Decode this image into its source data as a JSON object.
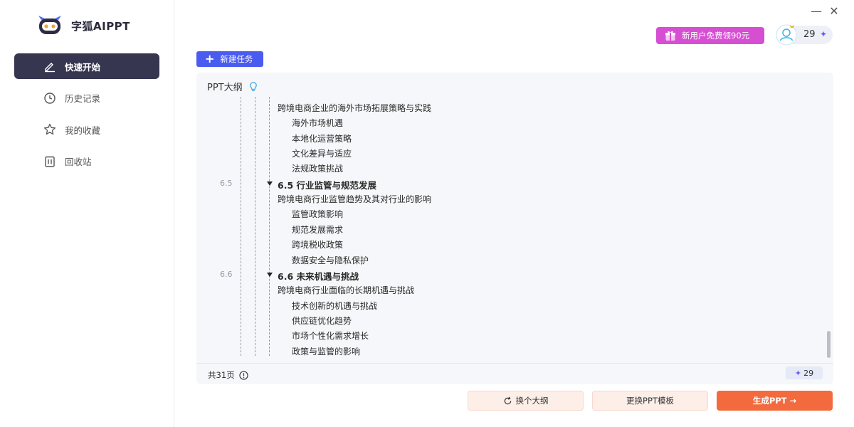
{
  "brand": {
    "name": "字狐AIPPT"
  },
  "sidebar": {
    "items": [
      {
        "label": "快速开始",
        "active": true,
        "icon": "pencil-icon"
      },
      {
        "label": "历史记录",
        "active": false,
        "icon": "clock-icon"
      },
      {
        "label": "我的收藏",
        "active": false,
        "icon": "star-icon"
      },
      {
        "label": "回收站",
        "active": false,
        "icon": "trash-icon"
      }
    ]
  },
  "window": {
    "minimize": "—",
    "close": "✕"
  },
  "header": {
    "promo_label": "新用户免费领90元",
    "credits": "29",
    "credits_symbol": "✦"
  },
  "toolbar": {
    "new_task_label": "新建任务",
    "new_task_icon": "+"
  },
  "outline": {
    "title": "PPT大纲",
    "rows": [
      {
        "kind": "desc",
        "text": "跨境电商企业的海外市场拓展策略与实践"
      },
      {
        "kind": "sub",
        "text": "海外市场机遇"
      },
      {
        "kind": "sub",
        "text": "本地化运营策略"
      },
      {
        "kind": "sub",
        "text": "文化差异与适应"
      },
      {
        "kind": "sub",
        "text": "法规政策挑战"
      },
      {
        "kind": "section",
        "num": "6.5",
        "text": "6.5 行业监管与规范发展"
      },
      {
        "kind": "desc",
        "text": "跨境电商行业监管趋势及其对行业的影响"
      },
      {
        "kind": "sub",
        "text": "监管政策影响"
      },
      {
        "kind": "sub",
        "text": "规范发展需求"
      },
      {
        "kind": "sub",
        "text": "跨境税收政策"
      },
      {
        "kind": "sub",
        "text": "数据安全与隐私保护"
      },
      {
        "kind": "section",
        "num": "6.6",
        "text": "6.6 未来机遇与挑战"
      },
      {
        "kind": "desc",
        "text": "跨境电商行业面临的长期机遇与挑战"
      },
      {
        "kind": "sub",
        "text": "技术创新的机遇与挑战"
      },
      {
        "kind": "sub",
        "text": "供应链优化趋势"
      },
      {
        "kind": "sub",
        "text": "市场个性化需求增长"
      },
      {
        "kind": "sub",
        "text": "政策与监管的影响"
      }
    ],
    "page_count": "共31页",
    "cost": "29",
    "cost_symbol": "✦"
  },
  "actions": {
    "change_outline": "换个大纲",
    "change_template": "更换PPT模板",
    "generate": "生成PPT →"
  },
  "colors": {
    "accent": "#4a5cf0",
    "active_nav": "#363650",
    "promo": "#d64fd3",
    "primary_button": "#f26a3d"
  }
}
